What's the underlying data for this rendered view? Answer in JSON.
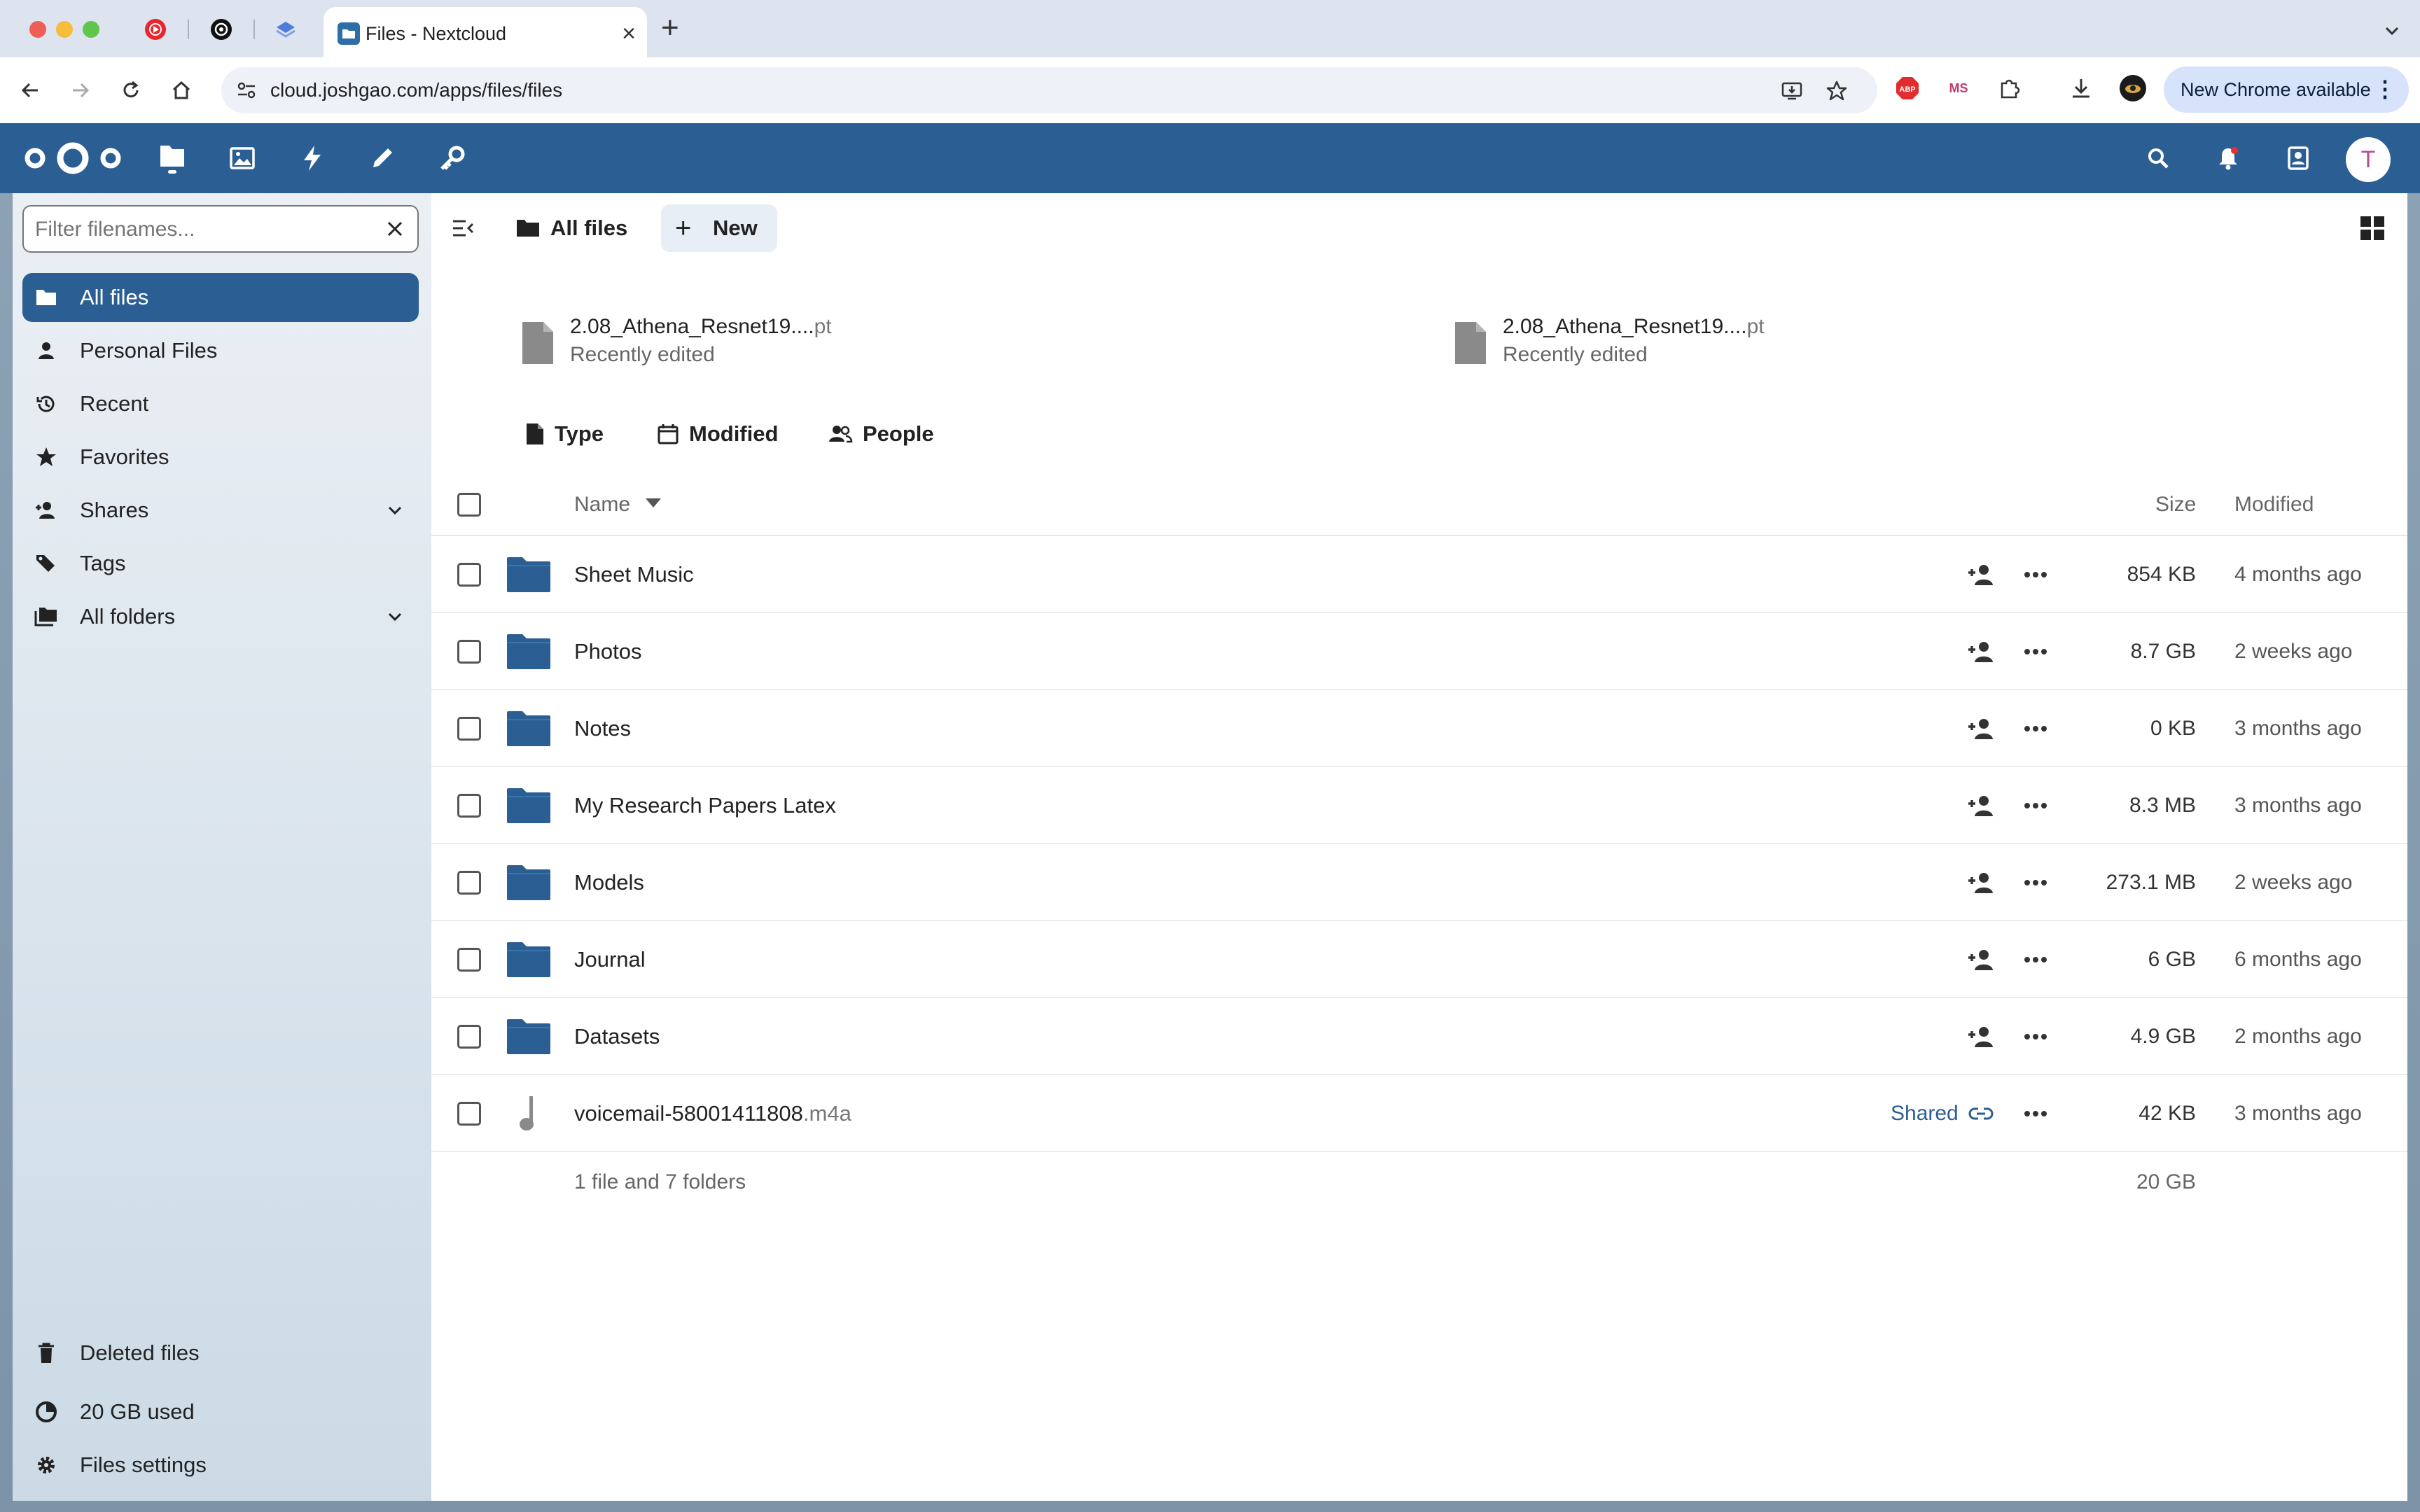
{
  "browser": {
    "active_tab_title": "Files - Nextcloud",
    "url": "cloud.joshgao.com/apps/files/files",
    "update_label": "New Chrome available",
    "ext_abp": "ABP",
    "ext_ms": "MS"
  },
  "header": {
    "avatar_initial": "T"
  },
  "sidebar": {
    "filter_placeholder": "Filter filenames...",
    "items": [
      {
        "label": "All files",
        "icon": "folder-icon",
        "active": true
      },
      {
        "label": "Personal Files",
        "icon": "person-icon"
      },
      {
        "label": "Recent",
        "icon": "history-icon"
      },
      {
        "label": "Favorites",
        "icon": "star-icon"
      },
      {
        "label": "Shares",
        "icon": "share-icon",
        "expandable": true
      },
      {
        "label": "Tags",
        "icon": "tag-icon"
      },
      {
        "label": "All folders",
        "icon": "folders-icon",
        "expandable": true
      }
    ],
    "bottom": [
      {
        "label": "Deleted files",
        "icon": "trash-icon"
      },
      {
        "label": "20 GB used",
        "icon": "pie-chart-icon"
      },
      {
        "label": "Files settings",
        "icon": "gear-icon"
      }
    ]
  },
  "main": {
    "breadcrumb": "All files",
    "new_label": "New",
    "recent": [
      {
        "name": "2.08_Athena_Resnet19....",
        "ext": "pt",
        "sub": "Recently edited"
      },
      {
        "name": "2.08_Athena_Resnet19....",
        "ext": "pt",
        "sub": "Recently edited"
      }
    ],
    "filters": [
      {
        "label": "Type",
        "icon": "file-icon"
      },
      {
        "label": "Modified",
        "icon": "calendar-icon"
      },
      {
        "label": "People",
        "icon": "people-icon"
      }
    ],
    "columns": {
      "name": "Name",
      "size": "Size",
      "modified": "Modified"
    },
    "rows": [
      {
        "name": "Sheet Music",
        "ext": "",
        "type": "folder",
        "size": "854 KB",
        "modified": "4 months ago"
      },
      {
        "name": "Photos",
        "ext": "",
        "type": "folder",
        "size": "8.7 GB",
        "modified": "2 weeks ago"
      },
      {
        "name": "Notes",
        "ext": "",
        "type": "folder",
        "size": "0 KB",
        "modified": "3 months ago"
      },
      {
        "name": "My Research Papers Latex",
        "ext": "",
        "type": "folder",
        "size": "8.3 MB",
        "modified": "3 months ago"
      },
      {
        "name": "Models",
        "ext": "",
        "type": "folder",
        "size": "273.1 MB",
        "modified": "2 weeks ago"
      },
      {
        "name": "Journal",
        "ext": "",
        "type": "folder",
        "size": "6 GB",
        "modified": "6 months ago"
      },
      {
        "name": "Datasets",
        "ext": "",
        "type": "folder",
        "size": "4.9 GB",
        "modified": "2 months ago"
      },
      {
        "name": "voicemail-58001411808",
        "ext": ".m4a",
        "type": "audio",
        "size": "42 KB",
        "modified": "3 months ago",
        "shared_label": "Shared"
      }
    ],
    "summary": {
      "text": "1 file and 7 folders",
      "total": "20 GB"
    }
  },
  "colors": {
    "brand": "#2b5f94",
    "folder": "#2b5f94",
    "file_grey": "#8a8a8a"
  }
}
